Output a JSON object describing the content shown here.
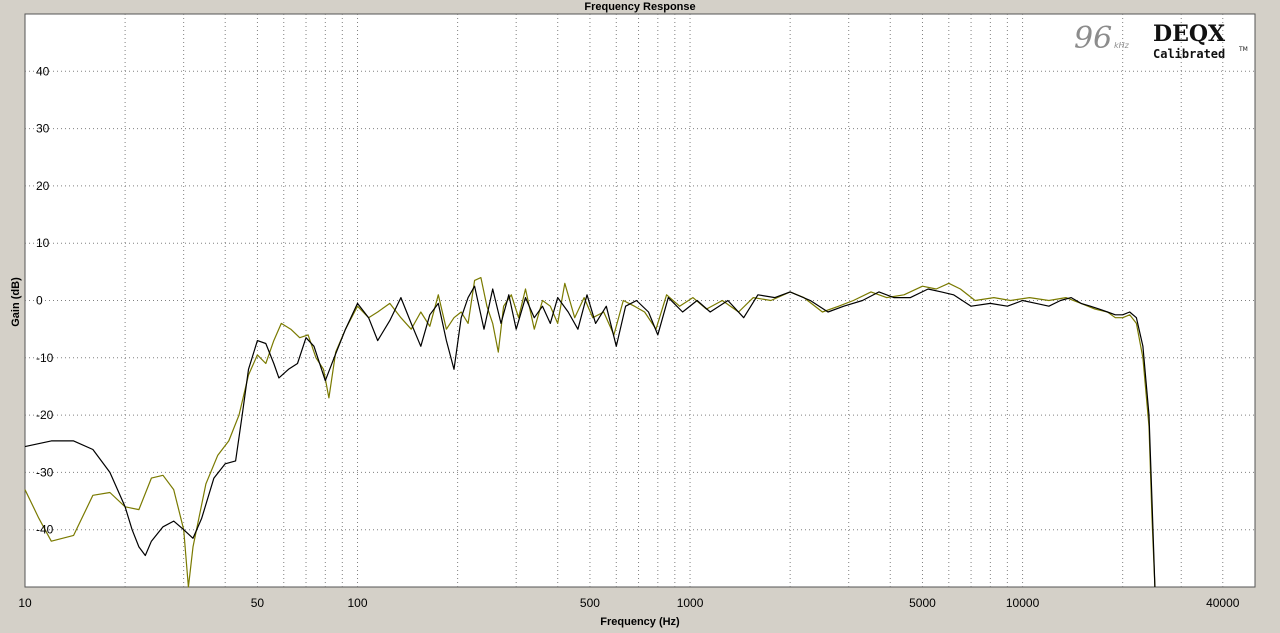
{
  "chart_data": {
    "type": "line",
    "title": "Frequency Response",
    "xlabel": "Frequency (Hz)",
    "ylabel": "Gain (dB)",
    "xscale": "log",
    "xlim": [
      10,
      50000
    ],
    "ylim": [
      -50,
      50
    ],
    "x_ticks": [
      10,
      50,
      100,
      500,
      1000,
      5000,
      10000,
      40000
    ],
    "y_ticks": [
      40,
      30,
      20,
      10,
      0,
      -10,
      -20,
      -30,
      -40
    ],
    "grid": true,
    "series": [
      {
        "color": "#000000",
        "points": [
          [
            10,
            -25.5
          ],
          [
            12,
            -24.5
          ],
          [
            14,
            -24.5
          ],
          [
            16,
            -26
          ],
          [
            18,
            -30
          ],
          [
            20,
            -36
          ],
          [
            21,
            -40
          ],
          [
            22,
            -43
          ],
          [
            23,
            -44.5
          ],
          [
            24,
            -42
          ],
          [
            26,
            -39.5
          ],
          [
            28,
            -38.5
          ],
          [
            30,
            -40
          ],
          [
            32,
            -41.5
          ],
          [
            34,
            -38
          ],
          [
            37,
            -31
          ],
          [
            40,
            -28.5
          ],
          [
            43,
            -28
          ],
          [
            45,
            -20
          ],
          [
            47,
            -12
          ],
          [
            50,
            -7
          ],
          [
            53,
            -7.5
          ],
          [
            56,
            -11
          ],
          [
            58,
            -13.5
          ],
          [
            62,
            -12
          ],
          [
            66,
            -11
          ],
          [
            70,
            -6.5
          ],
          [
            74,
            -8
          ],
          [
            80,
            -14
          ],
          [
            85,
            -10
          ],
          [
            92,
            -5
          ],
          [
            100,
            -0.5
          ],
          [
            108,
            -3
          ],
          [
            115,
            -7
          ],
          [
            125,
            -3.5
          ],
          [
            135,
            0.5
          ],
          [
            145,
            -4
          ],
          [
            155,
            -8
          ],
          [
            165,
            -2.5
          ],
          [
            175,
            -0.5
          ],
          [
            185,
            -7
          ],
          [
            195,
            -12
          ],
          [
            205,
            -3
          ],
          [
            215,
            0.5
          ],
          [
            225,
            2.5
          ],
          [
            240,
            -5
          ],
          [
            255,
            2
          ],
          [
            270,
            -4
          ],
          [
            285,
            1
          ],
          [
            300,
            -5
          ],
          [
            320,
            0.5
          ],
          [
            340,
            -3
          ],
          [
            360,
            -1
          ],
          [
            380,
            -4
          ],
          [
            400,
            0.5
          ],
          [
            430,
            -2
          ],
          [
            460,
            -5
          ],
          [
            490,
            1
          ],
          [
            520,
            -4
          ],
          [
            560,
            -1
          ],
          [
            600,
            -8
          ],
          [
            640,
            -1
          ],
          [
            690,
            0
          ],
          [
            750,
            -2
          ],
          [
            800,
            -6
          ],
          [
            860,
            0.5
          ],
          [
            950,
            -2
          ],
          [
            1050,
            0
          ],
          [
            1150,
            -2
          ],
          [
            1300,
            0
          ],
          [
            1450,
            -3
          ],
          [
            1600,
            1
          ],
          [
            1800,
            0.5
          ],
          [
            2000,
            1.5
          ],
          [
            2300,
            0
          ],
          [
            2600,
            -2
          ],
          [
            2900,
            -1
          ],
          [
            3300,
            0
          ],
          [
            3700,
            1.5
          ],
          [
            4100,
            0.5
          ],
          [
            4600,
            0.5
          ],
          [
            5200,
            2
          ],
          [
            5700,
            1.5
          ],
          [
            6200,
            1
          ],
          [
            7000,
            -1
          ],
          [
            8000,
            -0.5
          ],
          [
            9000,
            -1
          ],
          [
            10000,
            0
          ],
          [
            11000,
            -0.5
          ],
          [
            12000,
            -1
          ],
          [
            13000,
            0
          ],
          [
            14000,
            0.5
          ],
          [
            15000,
            -0.5
          ],
          [
            16000,
            -1
          ],
          [
            17000,
            -1.5
          ],
          [
            18000,
            -2
          ],
          [
            19000,
            -2.5
          ],
          [
            20000,
            -2.5
          ],
          [
            21000,
            -2
          ],
          [
            22000,
            -3
          ],
          [
            23000,
            -8
          ],
          [
            24000,
            -20
          ],
          [
            24500,
            -35
          ],
          [
            25000,
            -50
          ]
        ]
      },
      {
        "color": "#7a7a00",
        "points": [
          [
            10,
            -33
          ],
          [
            11,
            -38
          ],
          [
            12,
            -42
          ],
          [
            14,
            -41
          ],
          [
            16,
            -34
          ],
          [
            18,
            -33.5
          ],
          [
            20,
            -36
          ],
          [
            22,
            -36.5
          ],
          [
            24,
            -31
          ],
          [
            26,
            -30.5
          ],
          [
            28,
            -33
          ],
          [
            30,
            -40
          ],
          [
            31,
            -50
          ],
          [
            32,
            -43
          ],
          [
            35,
            -32
          ],
          [
            38,
            -27
          ],
          [
            41,
            -24.5
          ],
          [
            44,
            -20
          ],
          [
            47,
            -13
          ],
          [
            50,
            -9.5
          ],
          [
            53,
            -11
          ],
          [
            56,
            -7
          ],
          [
            59,
            -4
          ],
          [
            63,
            -5
          ],
          [
            67,
            -6.5
          ],
          [
            71,
            -6
          ],
          [
            75,
            -10
          ],
          [
            79,
            -12
          ],
          [
            82,
            -17
          ],
          [
            86,
            -9
          ],
          [
            92,
            -5
          ],
          [
            100,
            -1
          ],
          [
            108,
            -3
          ],
          [
            115,
            -2
          ],
          [
            125,
            -0.5
          ],
          [
            135,
            -3
          ],
          [
            145,
            -5
          ],
          [
            155,
            -2
          ],
          [
            165,
            -4.5
          ],
          [
            175,
            1
          ],
          [
            185,
            -5
          ],
          [
            195,
            -3
          ],
          [
            205,
            -2
          ],
          [
            215,
            -4
          ],
          [
            225,
            3.5
          ],
          [
            235,
            4
          ],
          [
            245,
            -1
          ],
          [
            255,
            -4
          ],
          [
            265,
            -9
          ],
          [
            275,
            -1
          ],
          [
            290,
            1
          ],
          [
            305,
            -3
          ],
          [
            320,
            2
          ],
          [
            340,
            -5
          ],
          [
            360,
            0
          ],
          [
            380,
            -1
          ],
          [
            400,
            -4
          ],
          [
            420,
            3
          ],
          [
            450,
            -3
          ],
          [
            480,
            0.5
          ],
          [
            510,
            -3
          ],
          [
            550,
            -2
          ],
          [
            590,
            -6
          ],
          [
            630,
            0
          ],
          [
            680,
            -1
          ],
          [
            730,
            -2
          ],
          [
            790,
            -5
          ],
          [
            850,
            1
          ],
          [
            930,
            -1
          ],
          [
            1020,
            0.5
          ],
          [
            1120,
            -1.5
          ],
          [
            1250,
            0
          ],
          [
            1400,
            -2
          ],
          [
            1550,
            0.5
          ],
          [
            1750,
            0
          ],
          [
            2000,
            1.5
          ],
          [
            2200,
            0.5
          ],
          [
            2500,
            -2
          ],
          [
            2800,
            -1
          ],
          [
            3100,
            0
          ],
          [
            3500,
            1.5
          ],
          [
            3900,
            0.5
          ],
          [
            4400,
            1
          ],
          [
            5000,
            2.5
          ],
          [
            5500,
            2
          ],
          [
            6000,
            3
          ],
          [
            6500,
            2
          ],
          [
            7200,
            0
          ],
          [
            8200,
            0.5
          ],
          [
            9200,
            0
          ],
          [
            10500,
            0.5
          ],
          [
            12000,
            0
          ],
          [
            13500,
            0.5
          ],
          [
            15000,
            -0.5
          ],
          [
            16500,
            -1.5
          ],
          [
            18000,
            -2
          ],
          [
            19000,
            -3
          ],
          [
            20000,
            -3
          ],
          [
            21000,
            -2.5
          ],
          [
            22000,
            -4
          ],
          [
            23000,
            -10
          ],
          [
            24000,
            -22
          ],
          [
            24500,
            -38
          ],
          [
            25000,
            -50
          ]
        ]
      }
    ]
  },
  "logo": {
    "rate_number": "96",
    "rate_unit": "kHz",
    "brand": "DEQX",
    "badge": "Calibrated",
    "trademark": "TM"
  },
  "colors": {
    "frame_bg": "#d4d0c8",
    "plot_bg": "#ffffff",
    "grid": "#808080"
  }
}
